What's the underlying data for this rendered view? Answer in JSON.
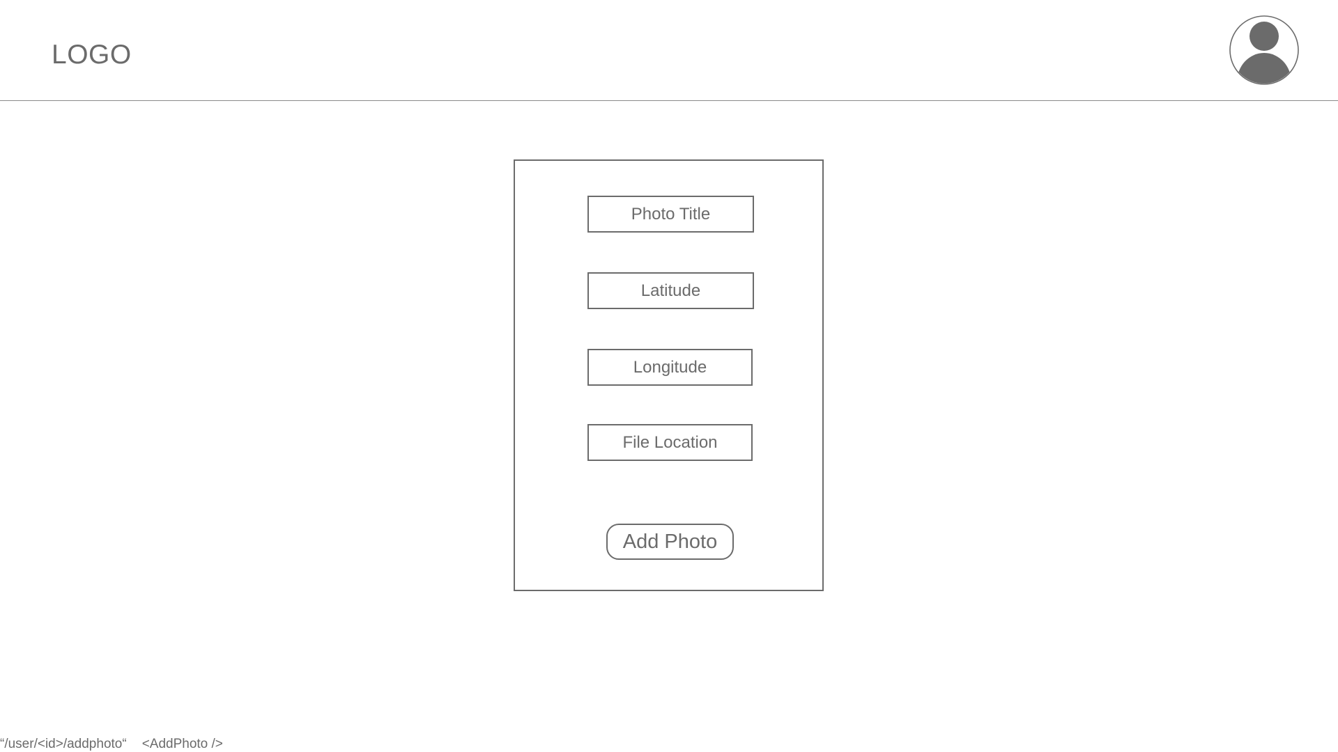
{
  "header": {
    "logo_text": "LOGO",
    "avatar_icon": "user-avatar-icon"
  },
  "form": {
    "photo_title_placeholder": "Photo Title",
    "latitude_placeholder": "Latitude",
    "longitude_placeholder": "Longitude",
    "file_location_placeholder": "File Location",
    "submit_label": "Add Photo"
  },
  "footer": {
    "route": "“/user/<id>/addphoto“",
    "component": "<AddPhoto />"
  },
  "colors": {
    "stroke": "#6b6b6b",
    "background": "#ffffff"
  }
}
